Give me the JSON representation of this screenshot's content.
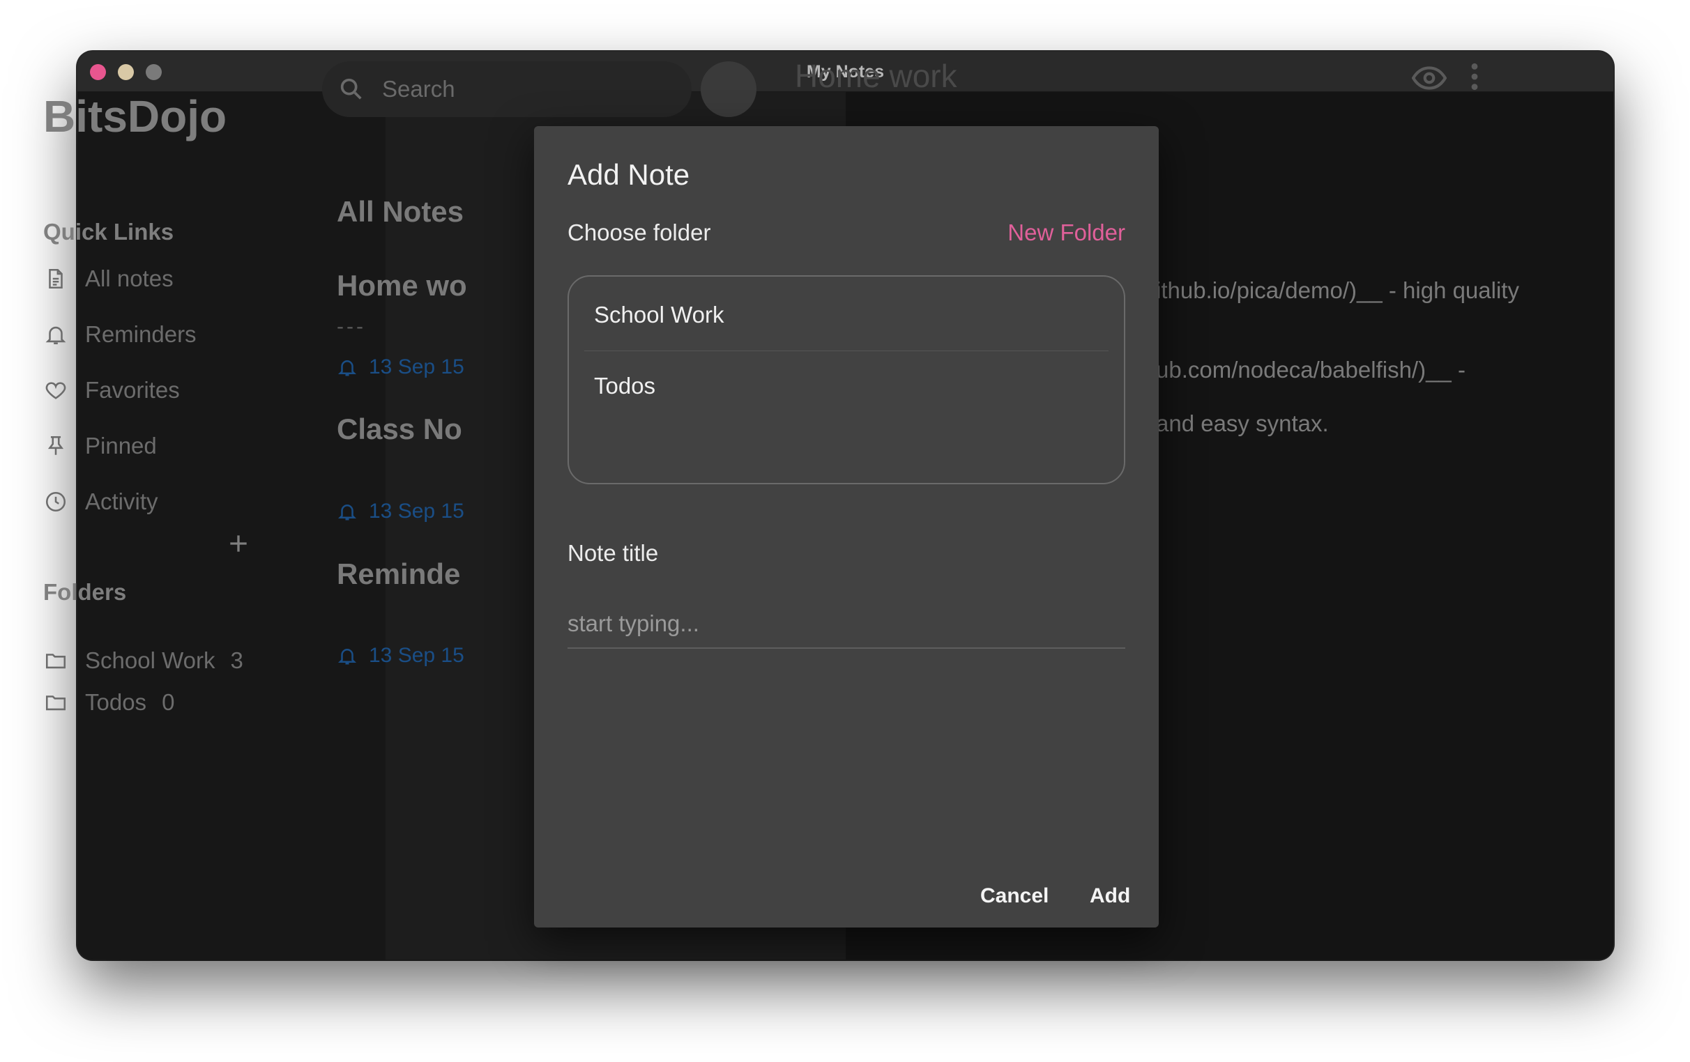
{
  "window": {
    "title": "My Notes"
  },
  "sidebar": {
    "brand": "BitsDojo",
    "quick_links_title": "Quick Links",
    "quick_links": [
      {
        "label": "All notes",
        "icon": "document-icon"
      },
      {
        "label": "Reminders",
        "icon": "bell-icon"
      },
      {
        "label": "Favorites",
        "icon": "heart-icon"
      },
      {
        "label": "Pinned",
        "icon": "pin-icon"
      },
      {
        "label": "Activity",
        "icon": "clock-icon"
      }
    ],
    "folders_title": "Folders",
    "folders": [
      {
        "label": "School Work",
        "count": "3"
      },
      {
        "label": "Todos",
        "count": "0"
      }
    ]
  },
  "notelist": {
    "search_placeholder": "Search",
    "heading": "All Notes",
    "notes": [
      {
        "title": "Home wo",
        "separator": "---",
        "date": "13 Sep 15"
      },
      {
        "title": "Class No",
        "date": "13 Sep 15"
      },
      {
        "title": "Reminde",
        "date": "13 Sep 15"
      }
    ]
  },
  "editor": {
    "title": "Home work",
    "lines": [
      "ithub.io/pica/demo/)__ - high quality",
      "ub.com/nodeca/babelfish/)__ -",
      "and easy syntax."
    ]
  },
  "modal": {
    "title": "Add Note",
    "choose_folder_label": "Choose folder",
    "new_folder_label": "New Folder",
    "folder_options": [
      "School Work",
      "Todos"
    ],
    "note_title_label": "Note title",
    "note_title_placeholder": "start typing...",
    "cancel_label": "Cancel",
    "add_label": "Add"
  },
  "colors": {
    "accent_pink": "#e0609a",
    "reminder_blue": "#1a4e86",
    "modal_bg": "#424242"
  }
}
